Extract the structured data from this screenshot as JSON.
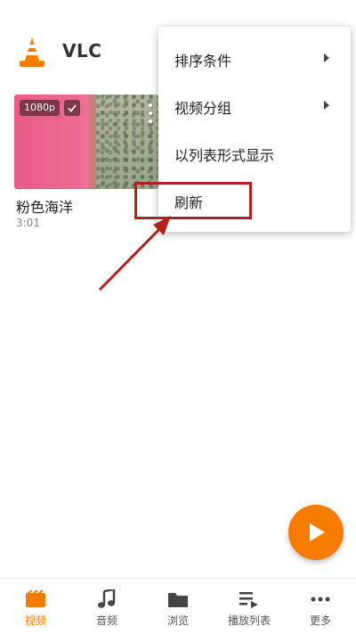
{
  "app": {
    "title": "VLC",
    "accent": "#f57c00"
  },
  "video": {
    "title": "粉色海洋",
    "duration": "3:01",
    "quality_badge": "1080p",
    "selected_icon": "check-icon",
    "more_icon": "more-vertical-icon"
  },
  "popup_menu": {
    "items": [
      {
        "label": "排序条件",
        "has_submenu": true
      },
      {
        "label": "视频分组",
        "has_submenu": true
      },
      {
        "label": "以列表形式显示",
        "has_submenu": false
      },
      {
        "label": "刷新",
        "has_submenu": false,
        "highlighted": true
      }
    ]
  },
  "annotation": {
    "color": "#b3211e"
  },
  "fab": {
    "icon": "play-icon"
  },
  "bottom_nav": {
    "items": [
      {
        "label": "视频",
        "icon": "video-icon",
        "active": true
      },
      {
        "label": "音频",
        "icon": "music-note-icon",
        "active": false
      },
      {
        "label": "浏览",
        "icon": "folder-icon",
        "active": false
      },
      {
        "label": "播放列表",
        "icon": "playlist-icon",
        "active": false
      },
      {
        "label": "更多",
        "icon": "more-horizontal-icon",
        "active": false
      }
    ]
  }
}
